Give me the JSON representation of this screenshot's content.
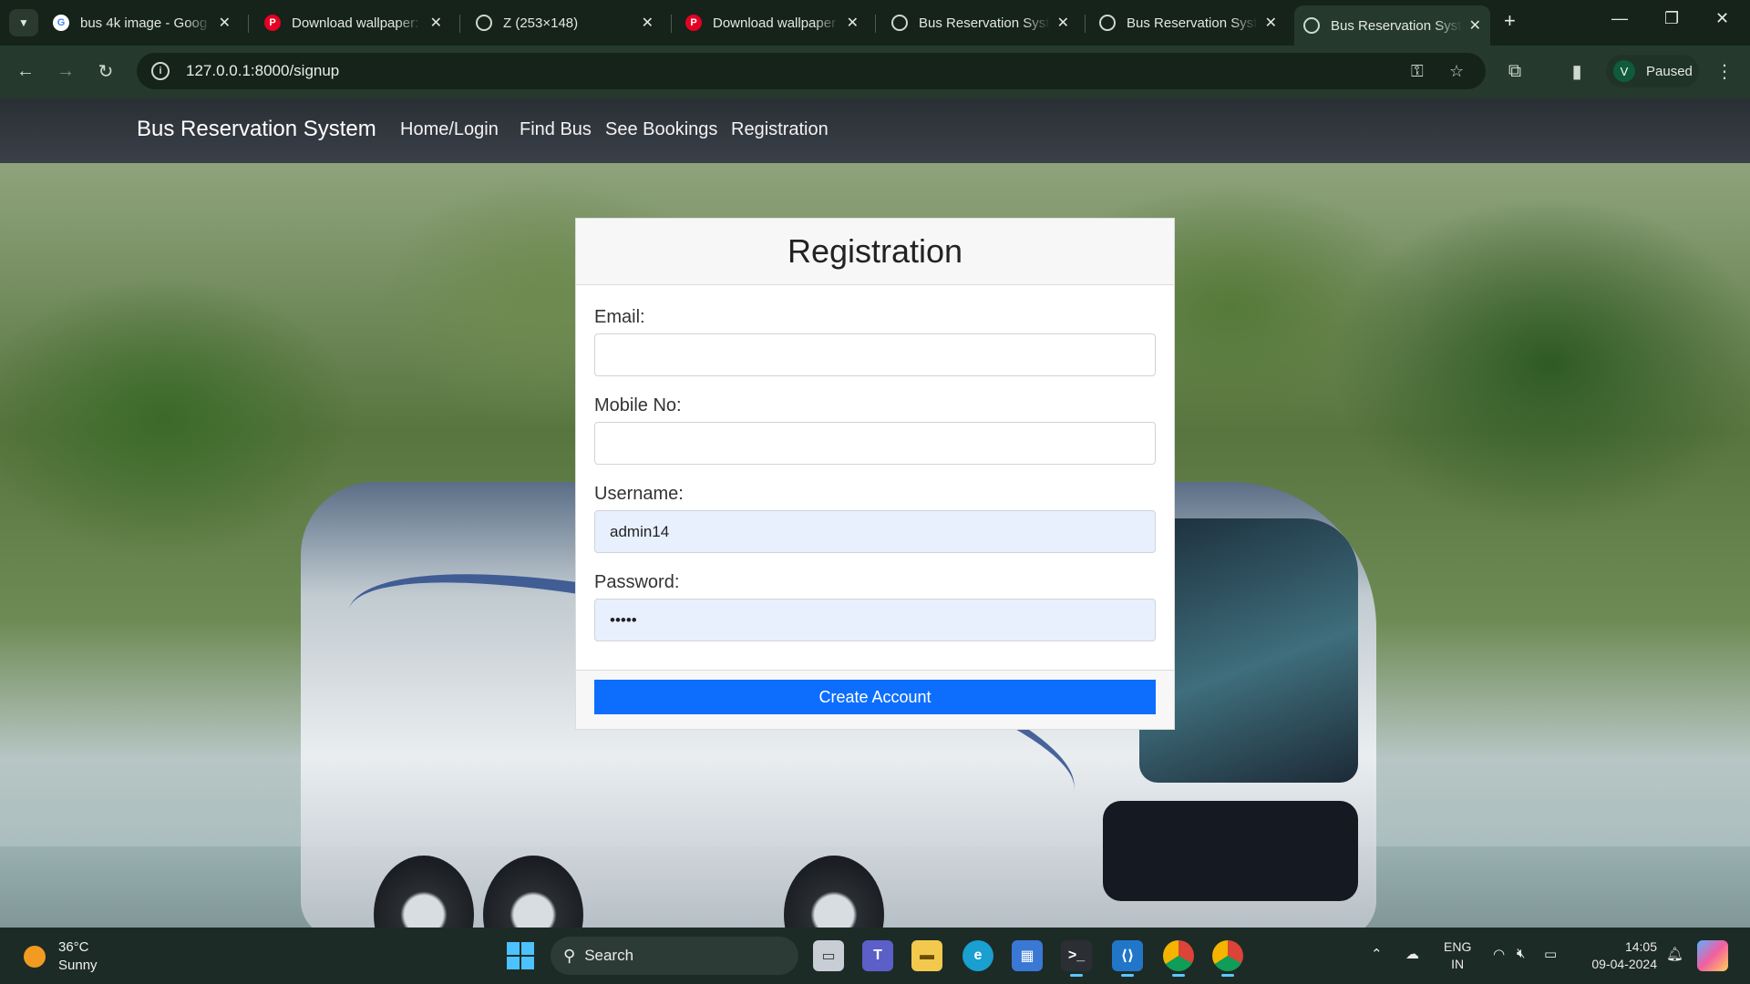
{
  "browser": {
    "tabs": [
      {
        "title": "bus 4k image - Goog",
        "favicon": "google-icon",
        "color": "#ffffff"
      },
      {
        "title": "Download wallpaper:",
        "favicon": "pinterest-icon",
        "color": "#e60023"
      },
      {
        "title": "Z (253×148)",
        "favicon": "globe-icon",
        "color": "#cfd8cf"
      },
      {
        "title": "Download wallpaper",
        "favicon": "pinterest-icon",
        "color": "#e60023"
      },
      {
        "title": "Bus Reservation Syst",
        "favicon": "globe-icon",
        "color": "#cfd8cf"
      },
      {
        "title": "Bus Reservation Syst",
        "favicon": "globe-icon",
        "color": "#cfd8cf"
      },
      {
        "title": "Bus Reservation Syst",
        "favicon": "globe-icon",
        "color": "#cfd8cf"
      }
    ],
    "url": "127.0.0.1:8000/signup",
    "profile": {
      "initial": "V",
      "status": "Paused"
    }
  },
  "navbar": {
    "brand": "Bus Reservation System",
    "links": [
      "Home/Login",
      "Find Bus",
      "See Bookings",
      "Registration"
    ]
  },
  "form": {
    "title": "Registration",
    "email": {
      "label": "Email:",
      "value": ""
    },
    "mobile": {
      "label": "Mobile No:",
      "value": ""
    },
    "username": {
      "label": "Username:",
      "value": "admin14"
    },
    "password": {
      "label": "Password:",
      "value": "•••••"
    },
    "submit": "Create Account",
    "primary_color": "#0d6efd"
  },
  "taskbar": {
    "weather": {
      "temp": "36°C",
      "condition": "Sunny"
    },
    "search": "Search",
    "language": {
      "line1": "ENG",
      "line2": "IN"
    },
    "clock": {
      "time": "14:05",
      "date": "09-04-2024"
    }
  }
}
